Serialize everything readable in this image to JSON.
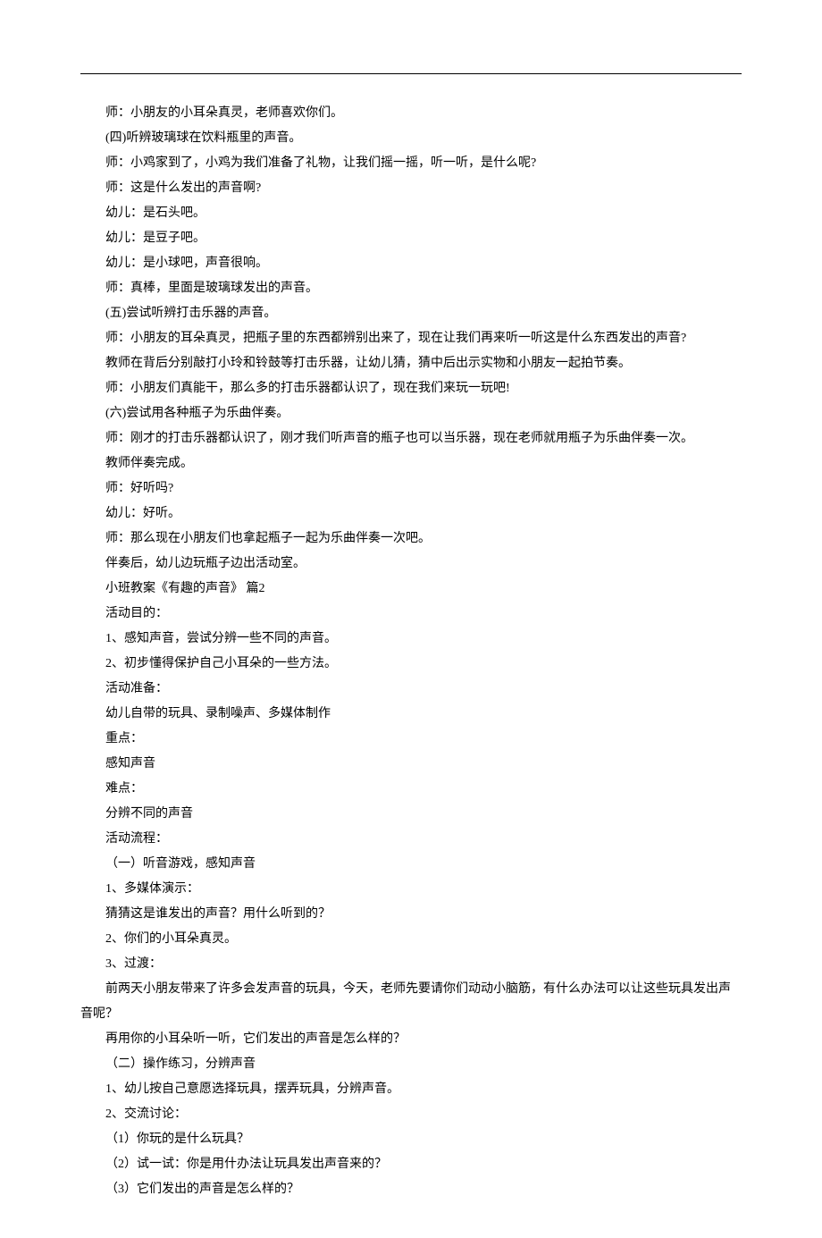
{
  "lines": [
    "师：小朋友的小耳朵真灵，老师喜欢你们。",
    "(四)听辨玻璃球在饮料瓶里的声音。",
    "师：小鸡家到了，小鸡为我们准备了礼物，让我们摇一摇，听一听，是什么呢?",
    "师：这是什么发出的声音啊?",
    "幼儿：是石头吧。",
    "幼儿：是豆子吧。",
    "幼儿：是小球吧，声音很响。",
    "师：真棒，里面是玻璃球发出的声音。",
    "(五)尝试听辨打击乐器的声音。",
    "师：小朋友的耳朵真灵，把瓶子里的东西都辨别出来了，现在让我们再来听一听这是什么东西发出的声音?",
    "教师在背后分别敲打小玲和铃鼓等打击乐器，让幼儿猜，猜中后出示实物和小朋友一起拍节奏。",
    "师：小朋友们真能干，那么多的打击乐器都认识了，现在我们来玩一玩吧!",
    "(六)尝试用各种瓶子为乐曲伴奏。",
    "师：刚才的打击乐器都认识了，刚才我们听声音的瓶子也可以当乐器，现在老师就用瓶子为乐曲伴奏一次。",
    "教师伴奏完成。",
    "师：好听吗?",
    "幼儿：好听。",
    "师：那么现在小朋友们也拿起瓶子一起为乐曲伴奏一次吧。",
    "伴奏后，幼儿边玩瓶子边出活动室。",
    "小班教案《有趣的声音》 篇2",
    "活动目的：",
    "1、感知声音，尝试分辨一些不同的声音。",
    "2、初步懂得保护自己小耳朵的一些方法。",
    "活动准备：",
    "幼儿自带的玩具、录制噪声、多媒体制作",
    "重点：",
    "感知声音",
    "难点：",
    "分辨不同的声音",
    "活动流程：",
    "（一）听音游戏，感知声音",
    "1、多媒体演示：",
    "猜猜这是谁发出的声音？用什么听到的？",
    "2、你们的小耳朵真灵。",
    "3、过渡：",
    "前两天小朋友带来了许多会发声音的玩具，今天，老师先要请你们动动小脑筋，有什么办法可以让这些玩具发出声",
    "再用你的小耳朵听一听，它们发出的声音是怎么样的？",
    "（二）操作练习，分辨声音",
    "1、幼儿按自己意愿选择玩具，摆弄玩具，分辨声音。",
    "2、交流讨论：",
    "（1）你玩的是什么玩具？",
    "（2）试一试：你是用什办法让玩具发出声音来的？",
    "（3）它们发出的声音是怎么样的？"
  ],
  "line_noindent": "音呢？"
}
